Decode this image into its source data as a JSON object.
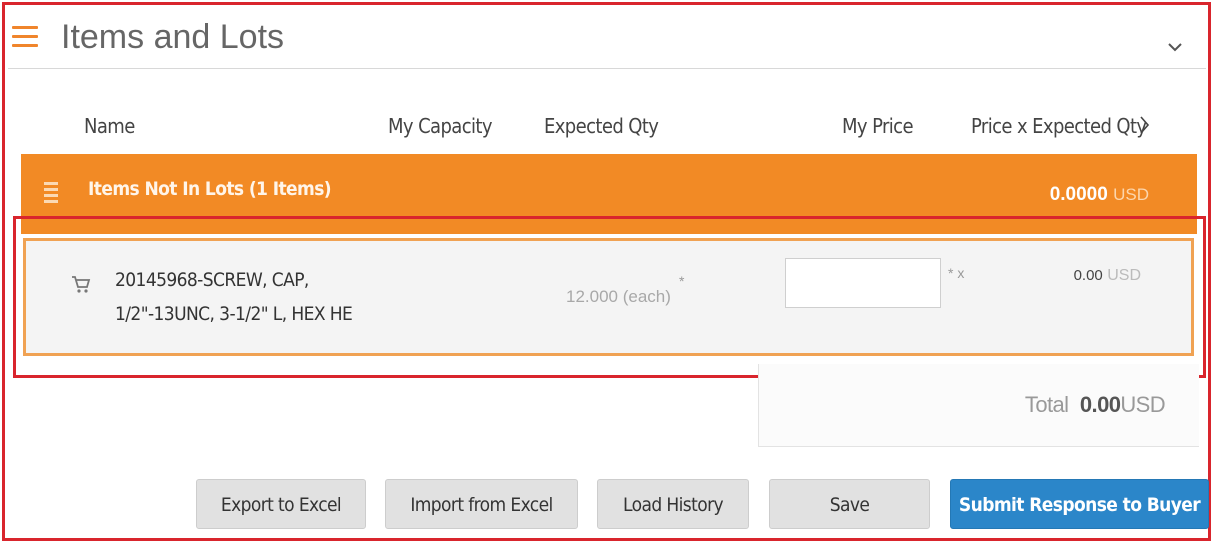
{
  "header": {
    "title": "Items and Lots",
    "menu_icon": "hamburger-menu-icon",
    "collapse_icon": "chevron-down-icon"
  },
  "columns": {
    "name": "Name",
    "my_capacity": "My Capacity",
    "expected_qty": "Expected Qty",
    "my_price": "My Price",
    "price_x_expected_qty": "Price x Expected Qty"
  },
  "lot_group": {
    "label": "Items Not In Lots (1 Items)",
    "total": "0.0000",
    "currency": "USD"
  },
  "item": {
    "name_line1": "20145968-SCREW, CAP,",
    "name_line2": "1/2\"-13UNC, 3-1/2\" L, HEX HE",
    "expected_qty": "12.000 (each)",
    "required_mark": "*",
    "price_value": "",
    "price_suffix": "* x",
    "row_total": "0.00",
    "row_currency": "USD"
  },
  "summary": {
    "label": "Total",
    "value": "0.00",
    "currency": "USD"
  },
  "buttons": {
    "export": "Export to Excel",
    "import": "Import from Excel",
    "history": "Load History",
    "save": "Save",
    "submit": "Submit Response to Buyer"
  },
  "colors": {
    "accent_orange": "#f28a25",
    "primary_blue": "#2b86c9",
    "highlight_red": "#d9252d"
  }
}
